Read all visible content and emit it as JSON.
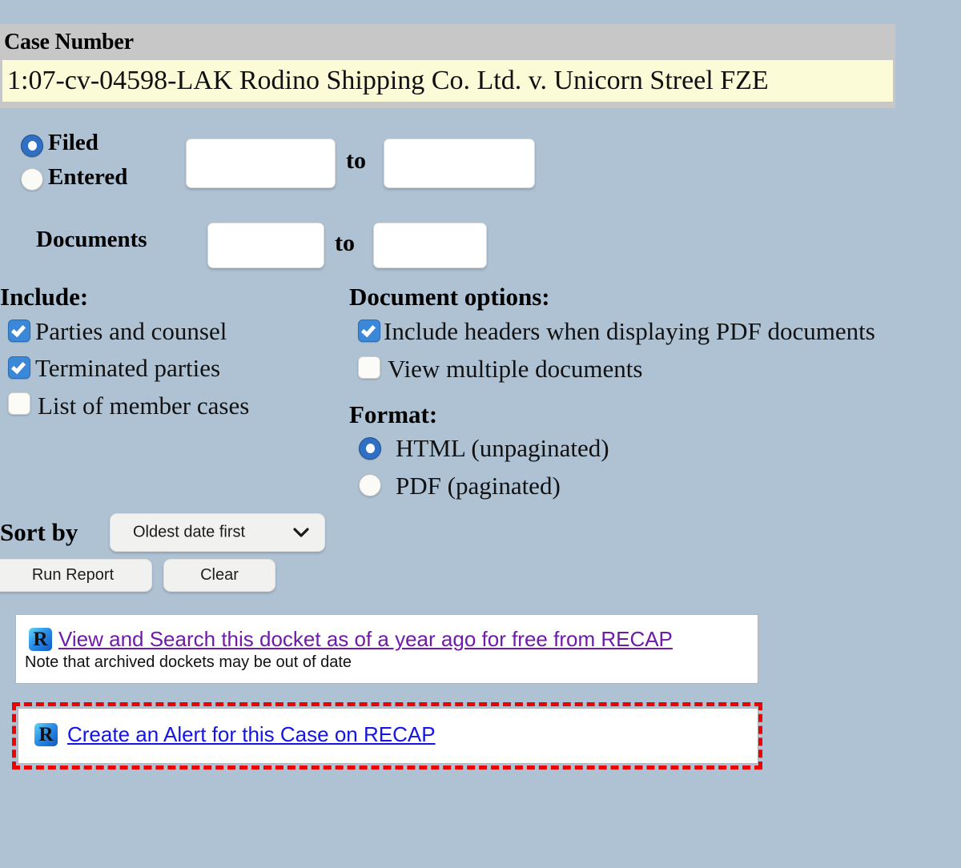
{
  "page": {
    "background_color": "#aec2d4",
    "header_bar_color": "#c7c7c7",
    "field_highlight_color": "#fbfbd8",
    "alert_highlight_color": "#ee0000"
  },
  "case": {
    "label": "Case Number",
    "value": "1:07-cv-04598-LAK Rodino Shipping Co. Ltd. v. Unicorn Streel FZE",
    "placeholder": ""
  },
  "date_range": {
    "filed_label": "Filed",
    "entered_label": "Entered",
    "selected": "Filed",
    "to_label": "to",
    "from_value": "",
    "to_value": "",
    "from_placeholder": "",
    "to_placeholder": ""
  },
  "documents_range": {
    "label": "Documents",
    "to_label": "to",
    "from_value": "",
    "to_value": "",
    "from_placeholder": "",
    "to_placeholder": ""
  },
  "include": {
    "heading": "Include:",
    "options": [
      {
        "label": "Parties and counsel",
        "checked": true
      },
      {
        "label": "Terminated parties",
        "checked": true
      },
      {
        "label": "List of member cases",
        "checked": false
      }
    ]
  },
  "document_options": {
    "heading": "Document options:",
    "options": [
      {
        "label": "Include headers when displaying PDF documents",
        "checked": true
      },
      {
        "label": "View multiple documents",
        "checked": false
      }
    ]
  },
  "format": {
    "heading": "Format:",
    "options": [
      {
        "label": "HTML (unpaginated)",
        "selected": true
      },
      {
        "label": "PDF (paginated)",
        "selected": false
      }
    ]
  },
  "sort": {
    "label": "Sort by",
    "selected": "Oldest date first",
    "caret_icon": "chevron-down-icon"
  },
  "buttons": {
    "run_report": "Run Report",
    "clear": "Clear"
  },
  "recap": {
    "icon_letter": "R",
    "icon_name": "recap-logo-icon",
    "archive": {
      "link": "View and Search this docket as of a year ago for free from RECAP",
      "note": "Note that archived dockets may be out of date"
    },
    "alert": {
      "link": "Create an Alert for this Case on RECAP"
    }
  }
}
